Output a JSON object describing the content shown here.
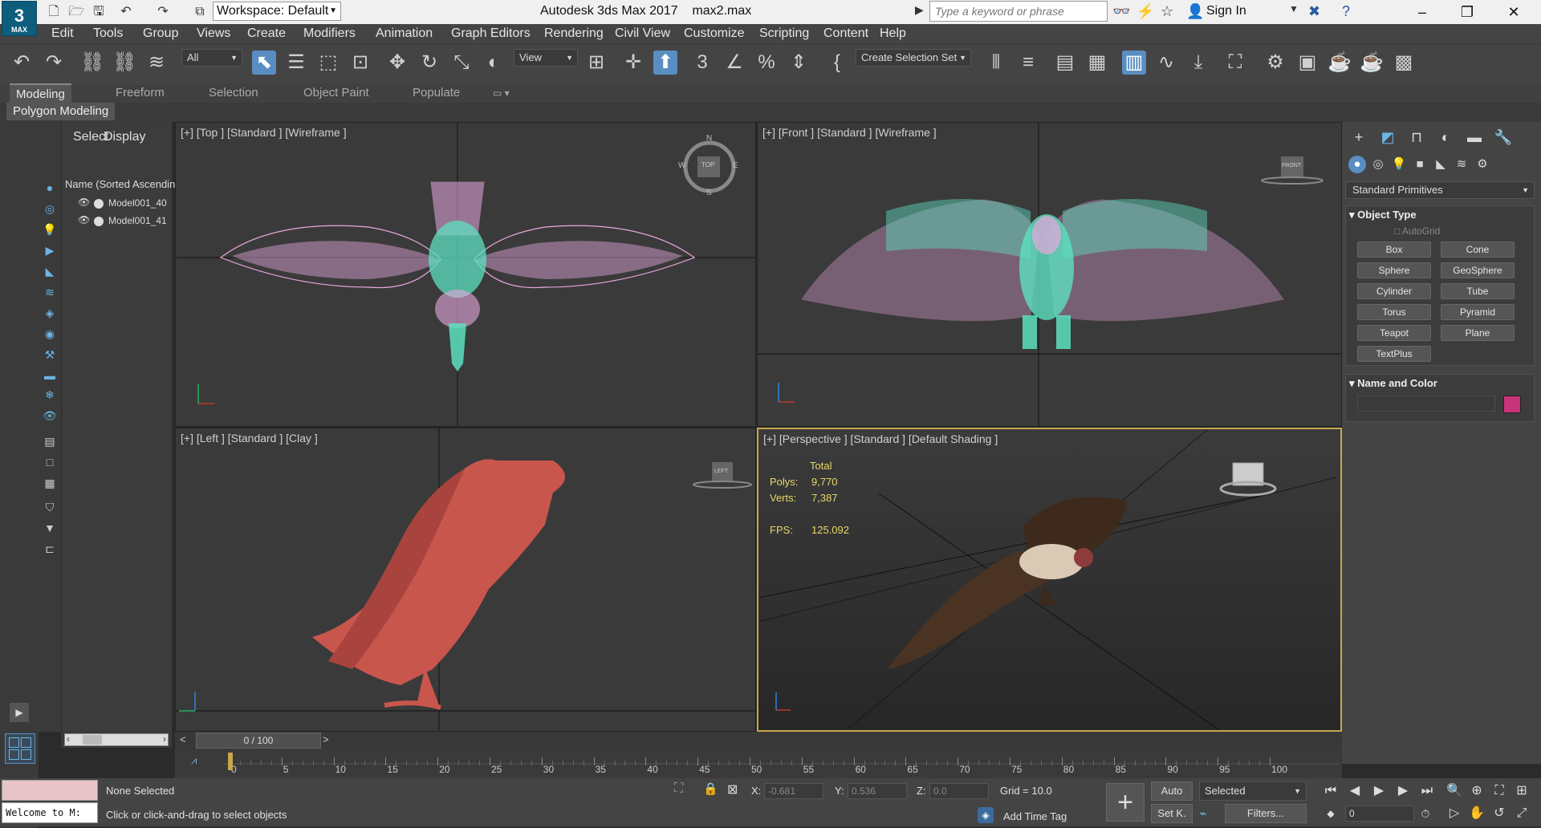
{
  "titlebar": {
    "workspace": "Workspace: Default",
    "app_title": "Autodesk 3ds Max 2017",
    "file_name": "max2.max",
    "search_placeholder": "Type a keyword or phrase",
    "sign_in": "Sign In",
    "logo_main": "3",
    "logo_sub": "MAX"
  },
  "menu": [
    "Edit",
    "Tools",
    "Group",
    "Views",
    "Create",
    "Modifiers",
    "Animation",
    "Graph Editors",
    "Rendering",
    "Civil View",
    "Customize",
    "Scripting",
    "Content",
    "Help"
  ],
  "toolbar": {
    "filter_select": "All",
    "ref_coord": "View",
    "selection_set": "Create Selection Set"
  },
  "ribbon": {
    "tabs": [
      "Modeling",
      "Freeform",
      "Selection",
      "Object Paint",
      "Populate"
    ],
    "active_tab": "Modeling",
    "panel_label": "Polygon Modeling"
  },
  "scene_explorer": {
    "tabs": [
      "Select",
      "Display"
    ],
    "column_header": "Name (Sorted Ascendin",
    "items": [
      "Model001_40",
      "Model001_41"
    ]
  },
  "viewports": {
    "top": "[+] [Top ] [Standard ] [Wireframe ]",
    "front": "[+] [Front ] [Standard ] [Wireframe ]",
    "left": "[+] [Left ] [Standard ] [Clay ]",
    "perspective": "[+] [Perspective ] [Standard ] [Default Shading ]",
    "stats": {
      "total_label": "Total",
      "polys_label": "Polys:",
      "polys_value": "9,770",
      "verts_label": "Verts:",
      "verts_value": "7,387",
      "fps_label": "FPS:",
      "fps_value": "125.092"
    },
    "viewcube_top": "TOP",
    "viewcube_front": "FRONT",
    "viewcube_left": "LEFT",
    "compass": [
      "N",
      "E",
      "S",
      "W"
    ]
  },
  "command_panel": {
    "primitive_dropdown": "Standard Primitives",
    "object_type_title": "Object Type",
    "autogrid": "AutoGrid",
    "primitives": [
      "Box",
      "Cone",
      "Sphere",
      "GeoSphere",
      "Cylinder",
      "Tube",
      "Torus",
      "Pyramid",
      "Teapot",
      "Plane",
      "TextPlus"
    ],
    "name_color_title": "Name and Color",
    "swatch_color": "#c8337a"
  },
  "timeline": {
    "slider_label": "0 / 100",
    "ticks": [
      "0",
      "5",
      "10",
      "15",
      "20",
      "25",
      "30",
      "35",
      "40",
      "45",
      "50",
      "55",
      "60",
      "65",
      "70",
      "75",
      "80",
      "85",
      "90",
      "95",
      "100"
    ]
  },
  "status": {
    "selection": "None Selected",
    "prompt": "Click or click-and-drag to select objects",
    "maxscript": "Welcome to M:",
    "x_label": "X:",
    "x_value": "-0.681",
    "y_label": "Y:",
    "y_value": "0.536",
    "z_label": "Z:",
    "z_value": "0.0",
    "grid": "Grid = 10.0",
    "add_time_tag": "Add Time Tag",
    "auto_key": "Auto",
    "set_key": "Set K.",
    "key_filter": "Selected",
    "filters": "Filters...",
    "frame": "0"
  }
}
